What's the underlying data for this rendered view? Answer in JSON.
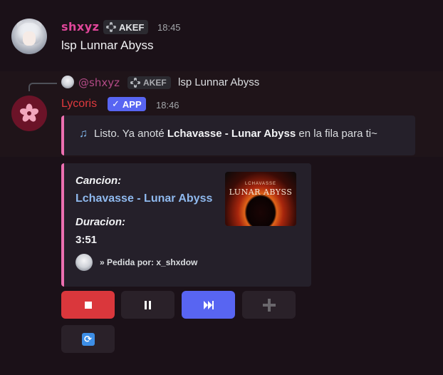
{
  "message1": {
    "username": "shxyz",
    "tag": "AKEF",
    "time": "18:45",
    "content": "lsp Lunnar Abyss"
  },
  "message2": {
    "reply": {
      "username": "@shxyz",
      "tag": "AKEF",
      "content": "lsp Lunnar Abyss"
    },
    "username": "Lycoris",
    "app_tag": "APP",
    "time": "18:46",
    "embed1": {
      "prefix": "Listo. Ya anoté ",
      "bold": "Lchavasse - Lunar Abyss",
      "suffix": " en la fila para ti~",
      "icon": "music-note-icon",
      "border_color": "#ec6fb0"
    },
    "embed2": {
      "song_label": "Cancion:",
      "song_title": "Lchavasse - Lunar Abyss",
      "duration_label": "Duracion:",
      "duration": "3:51",
      "footer": "» Pedida por: x_shxdow",
      "thumbnail_title": "LUNAR ABYSS",
      "thumbnail_sub": "LCHAVASSE"
    },
    "buttons": [
      {
        "name": "stop",
        "icon": "stop-icon",
        "color": "#da373c"
      },
      {
        "name": "pause",
        "icon": "pause-icon",
        "color": "#2a2129"
      },
      {
        "name": "skip",
        "icon": "skip-icon",
        "color": "#5865f2"
      },
      {
        "name": "add",
        "icon": "plus-icon",
        "color": "#2a2129"
      },
      {
        "name": "loop",
        "icon": "loop-icon",
        "color": "#2a2129"
      }
    ]
  },
  "colors": {
    "background": "#1b1118",
    "user_name": "#e0469a",
    "bot_name": "#e03a3e",
    "app_badge": "#5865f2",
    "link": "#8fb9ee"
  }
}
